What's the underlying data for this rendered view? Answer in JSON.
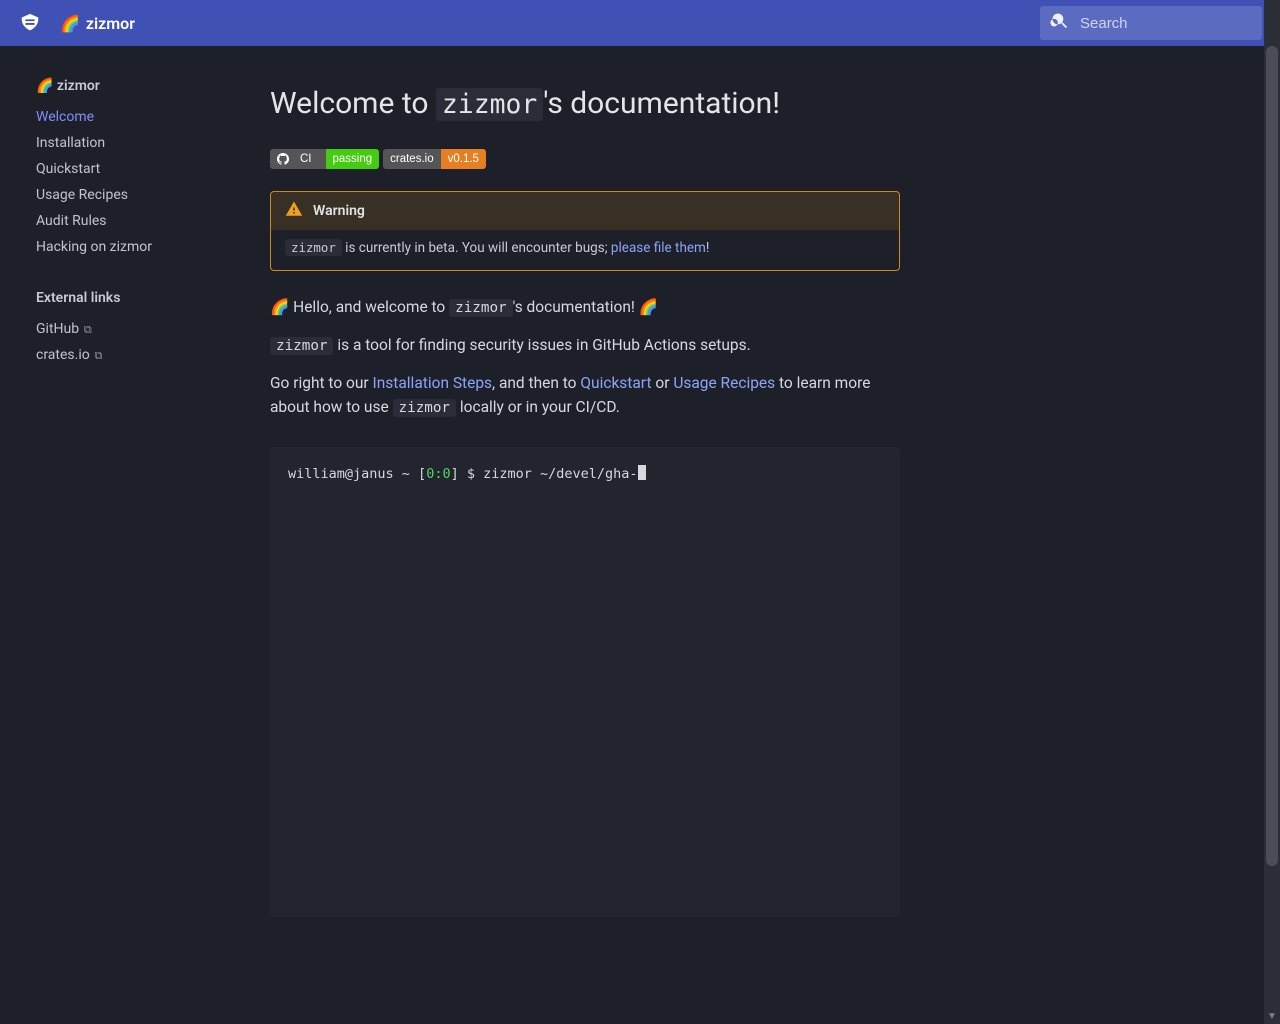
{
  "header": {
    "title_prefix": "🌈",
    "title": "zizmor"
  },
  "search": {
    "placeholder": "Search"
  },
  "sidebar": {
    "project_label": "🌈 zizmor",
    "nav": [
      {
        "label": "Welcome",
        "active": true
      },
      {
        "label": "Installation"
      },
      {
        "label": "Quickstart"
      },
      {
        "label": "Usage Recipes"
      },
      {
        "label": "Audit Rules"
      },
      {
        "label": "Hacking on zizmor"
      }
    ],
    "external_heading": "External links",
    "external": [
      {
        "label": "GitHub"
      },
      {
        "label": "crates.io"
      }
    ]
  },
  "page": {
    "h1_pre": "Welcome to ",
    "h1_code": "zizmor",
    "h1_post": "'s documentation!"
  },
  "badges": {
    "ci_left": "CI",
    "ci_right": "passing",
    "crates_left": "crates.io",
    "crates_right": "v0.1.5"
  },
  "warning": {
    "title": "Warning",
    "code": "zizmor",
    "text_mid": " is currently in beta. You will encounter bugs; ",
    "link": "please file them",
    "text_end": "!"
  },
  "intro": {
    "p1_pre": "🌈 Hello, and welcome to ",
    "p1_code": "zizmor",
    "p1_post": "'s documentation! 🌈",
    "p2_code": "zizmor",
    "p2_post": " is a tool for finding security issues in GitHub Actions setups.",
    "p3_pre": "Go right to our ",
    "p3_link1": "Installation Steps",
    "p3_mid1": ", and then to ",
    "p3_link2": "Quickstart",
    "p3_mid2": " or ",
    "p3_link3": "Usage Recipes",
    "p3_mid3": " to learn more about how to use ",
    "p3_code": "zizmor",
    "p3_end": " locally or in your CI/CD."
  },
  "terminal": {
    "user_host": "william@janus ~ ",
    "bracket_open": "[",
    "zero1": "0",
    "colon": ":",
    "zero2": "0",
    "bracket_close": "] $ ",
    "cmd": "zizmor ~/devel/gha-"
  }
}
